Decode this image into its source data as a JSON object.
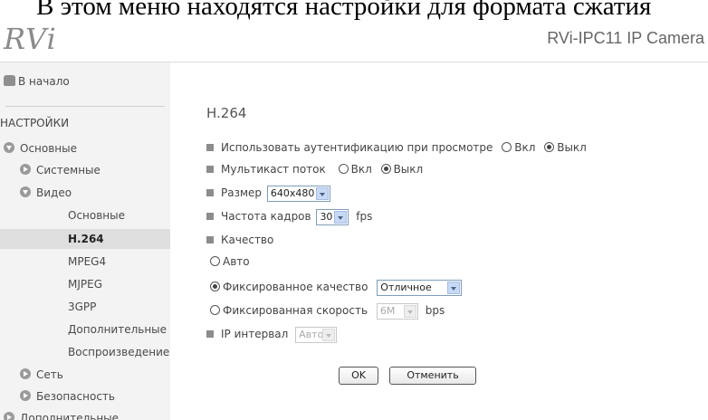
{
  "document": {
    "caption": "В этом меню находятся настройки для формата сжатия"
  },
  "header": {
    "logo": "RVi",
    "title": "RVi-IPC11 IP Camera"
  },
  "sidebar": {
    "home": "В начало",
    "section": "НАСТРОЙКИ",
    "items": [
      {
        "label": "Основные"
      },
      {
        "label": "Системные"
      },
      {
        "label": "Видео"
      },
      {
        "label": "Основные"
      },
      {
        "label": "H.264"
      },
      {
        "label": "MPEG4"
      },
      {
        "label": "MJPEG"
      },
      {
        "label": "3GPP"
      },
      {
        "label": "Дополнительные"
      },
      {
        "label": "Воспроизведение"
      },
      {
        "label": "Сеть"
      },
      {
        "label": "Безопасность"
      },
      {
        "label": "Дополнительные"
      }
    ]
  },
  "main": {
    "title": "H.264",
    "auth": {
      "label": "Использовать аутентификацию при просмотре",
      "on": "Вкл",
      "off": "Выкл"
    },
    "multicast": {
      "label": "Мультикаст поток",
      "on": "Вкл",
      "off": "Выкл"
    },
    "size": {
      "label": "Размер",
      "value": "640x480"
    },
    "framerate": {
      "label": "Частота кадров",
      "value": "30",
      "unit": "fps"
    },
    "quality": {
      "label": "Качество",
      "auto": "Авто",
      "fixed_quality": "Фиксированное качество",
      "fixed_quality_value": "Отличное",
      "fixed_rate": "Фиксированная скорость",
      "fixed_rate_value": "6M",
      "fixed_rate_unit": "bps"
    },
    "ip_interval": {
      "label": "IP интервал",
      "value": "Авто"
    },
    "ok_label": "OK",
    "cancel_label": "Отменить"
  }
}
